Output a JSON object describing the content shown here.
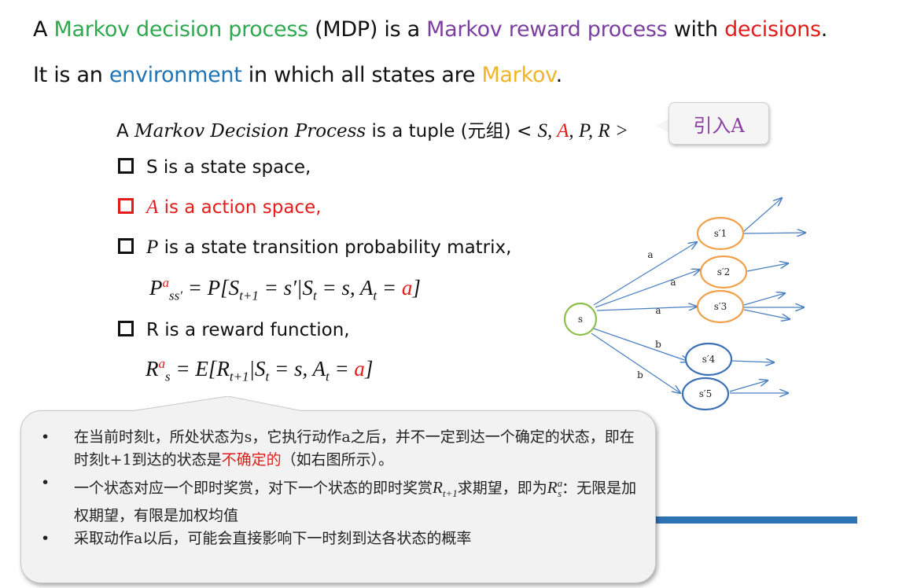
{
  "heading": {
    "line1": {
      "p1": "A ",
      "p2": "Markov decision process",
      "p3": " (MDP) is a ",
      "p4": "Markov reward process",
      "p5": " with ",
      "p6": "decisions",
      "p7": "."
    },
    "line2": {
      "p1": "It is an ",
      "p2": "environment",
      "p3": " in which all states are ",
      "p4": "Markov",
      "p5": "."
    }
  },
  "tuple": {
    "a": "A ",
    "italic": "Markov Decision Process",
    "b": " is a tuple (元组) < ",
    "s": "S, ",
    "A": "A",
    "rest": ", P, R >"
  },
  "callout": "引入A",
  "items": [
    {
      "text": "S is a state space,"
    },
    {
      "letter": "A",
      "text": " is a action space,"
    },
    {
      "letter": "P",
      "text": " is a state transition probability matrix,"
    },
    {
      "text": "R is a reward function,"
    }
  ],
  "formula_p": {
    "lhs": "P",
    "sup": "a",
    "sub": "ss′",
    "mid": " = P[S",
    "sub2": "t+1",
    "mid2": " = s′|S",
    "sub3": "t",
    "mid3": " = s, A",
    "sub4": "t",
    "eq": " = ",
    "a": "a",
    "end": "]"
  },
  "formula_r": {
    "lhs": "R",
    "sup": "a",
    "sub": "s",
    "mid": " = E[R",
    "sub2": "t+1",
    "mid2": "|S",
    "sub3": "t",
    "mid3": " = s, A",
    "sub4": "t",
    "eq": " = ",
    "a": "a",
    "end": "]"
  },
  "diagram": {
    "nodes": [
      "s",
      "s′1",
      "s′2",
      "s′3",
      "s′4",
      "s′5"
    ],
    "edge_labels": [
      "a",
      "a",
      "a",
      "b",
      "b"
    ]
  },
  "bullets": {
    "b1": {
      "pre": "在当前时刻t，所处状态为s，它执行动作a之后，并不一定到达一个确定的状态，即在时刻t+1到达的状态是",
      "red": "不确定的",
      "post": "（如右图所示）。"
    },
    "b2": {
      "pre": "一个状态对应一个即时奖赏，对下一个状态的即时奖赏",
      "R": "R",
      "rsub": "t+1",
      "mid": "求期望，即为",
      "R2": "R",
      "r2sup": "a",
      "r2sub": "s",
      "post": "：无限是加权期望，有限是加权均值"
    },
    "b3": {
      "text": "采取动作a以后，可能会直接影响下一时刻到达各状态的概率"
    }
  },
  "colors": {
    "green": "#2fa84f",
    "purple": "#7b3fa0",
    "red": "#e31b1b",
    "blue": "#1f74b5",
    "gold": "#f0b428",
    "arrow": "#4a7fc1",
    "orange": "#f0a048",
    "node_blue": "#3b6fb6",
    "node_green": "#8cbf4a"
  }
}
